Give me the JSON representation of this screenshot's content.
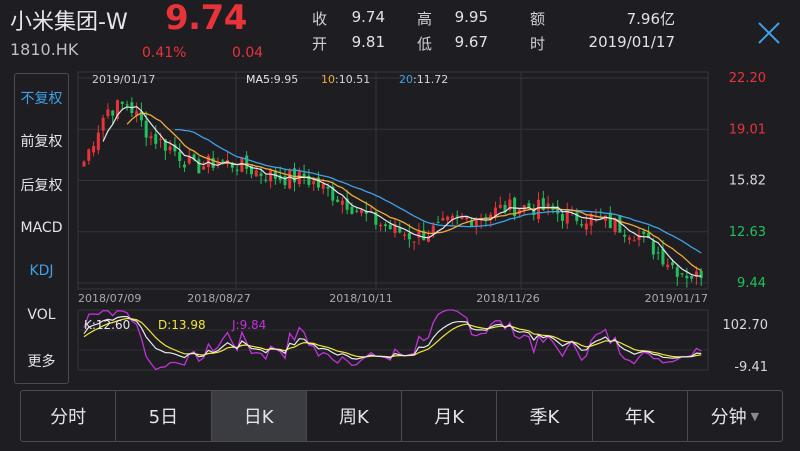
{
  "header": {
    "name": "小米集团-W",
    "code": "1810.HK",
    "price": "9.74",
    "change_pct": "0.41%",
    "change": "0.04",
    "info": [
      {
        "label": "收",
        "value": "9.74"
      },
      {
        "label": "开",
        "value": "9.81"
      },
      {
        "label": "高",
        "value": "9.95"
      },
      {
        "label": "低",
        "value": "9.67"
      },
      {
        "label": "额",
        "value": "7.96亿"
      },
      {
        "label": "时",
        "value": "2019/01/17"
      }
    ],
    "close_icon": "close-icon"
  },
  "sidebar": {
    "items": [
      {
        "label": "不复权",
        "active": true
      },
      {
        "label": "前复权",
        "active": false
      },
      {
        "label": "后复权",
        "active": false
      },
      {
        "label": "MACD",
        "active": false
      },
      {
        "label": "KDJ",
        "active": true
      },
      {
        "label": "VOL",
        "active": false
      },
      {
        "label": "更多",
        "active": false
      }
    ]
  },
  "tabs": [
    {
      "label": "分时",
      "active": false
    },
    {
      "label": "5日",
      "active": false
    },
    {
      "label": "日K",
      "active": true
    },
    {
      "label": "周K",
      "active": false
    },
    {
      "label": "月K",
      "active": false
    },
    {
      "label": "季K",
      "active": false
    },
    {
      "label": "年K",
      "active": false
    },
    {
      "label": "分钟",
      "active": false,
      "dropdown": true
    }
  ],
  "colors": {
    "up": "#e8333a",
    "down": "#21c05b",
    "ma5": "#e8e8ec",
    "ma10": "#f2a93a",
    "ma20": "#3fa0e6",
    "k": "#e8e8ec",
    "d": "#f2e63a",
    "j": "#c033d8"
  },
  "chart_data": [
    {
      "type": "candlestick",
      "current_date": "2019/01/17",
      "legend": [
        {
          "name": "MA5",
          "value": "9.95",
          "color": "#e8e8ec"
        },
        {
          "name": "10",
          "value": "10.51",
          "color": "#f2a93a"
        },
        {
          "name": "20",
          "value": "11.72",
          "color": "#3fa0e6"
        }
      ],
      "y_ticks": [
        "22.20",
        "19.01",
        "15.82",
        "12.63",
        "9.44"
      ],
      "x_ticks": [
        "2018/07/09",
        "2018/08/27",
        "2018/10/11",
        "2018/11/26",
        "2019/01/17"
      ],
      "ylim": [
        9.44,
        22.2
      ],
      "close_trend": [
        {
          "date": "2018/07/09",
          "value": 17.0
        },
        {
          "date": "2018/07/17",
          "value": 20.2
        },
        {
          "date": "2018/07/24",
          "value": 20.6
        },
        {
          "date": "2018/08/01",
          "value": 18.6
        },
        {
          "date": "2018/08/08",
          "value": 17.8
        },
        {
          "date": "2018/08/15",
          "value": 16.6
        },
        {
          "date": "2018/08/22",
          "value": 17.0
        },
        {
          "date": "2018/08/27",
          "value": 16.8
        },
        {
          "date": "2018/09/05",
          "value": 16.3
        },
        {
          "date": "2018/09/13",
          "value": 16.0
        },
        {
          "date": "2018/09/20",
          "value": 16.0
        },
        {
          "date": "2018/09/28",
          "value": 15.2
        },
        {
          "date": "2018/10/05",
          "value": 14.4
        },
        {
          "date": "2018/10/11",
          "value": 13.4
        },
        {
          "date": "2018/10/18",
          "value": 12.8
        },
        {
          "date": "2018/10/25",
          "value": 12.3
        },
        {
          "date": "2018/11/01",
          "value": 12.8
        },
        {
          "date": "2018/11/08",
          "value": 13.4
        },
        {
          "date": "2018/11/15",
          "value": 13.6
        },
        {
          "date": "2018/11/22",
          "value": 14.1
        },
        {
          "date": "2018/11/26",
          "value": 14.2
        },
        {
          "date": "2018/12/03",
          "value": 14.0
        },
        {
          "date": "2018/12/10",
          "value": 13.6
        },
        {
          "date": "2018/12/17",
          "value": 13.5
        },
        {
          "date": "2018/12/24",
          "value": 13.1
        },
        {
          "date": "2018/12/31",
          "value": 12.6
        },
        {
          "date": "2019/01/07",
          "value": 11.4
        },
        {
          "date": "2019/01/14",
          "value": 10.2
        },
        {
          "date": "2019/01/17",
          "value": 9.74
        }
      ]
    },
    {
      "type": "line",
      "indicator": "KDJ",
      "legend": [
        {
          "name": "K",
          "value": "12.60",
          "color": "#e8e8ec"
        },
        {
          "name": "D",
          "value": "13.98",
          "color": "#f2e63a"
        },
        {
          "name": "J",
          "value": "9.84",
          "color": "#c033d8"
        }
      ],
      "y_ticks": [
        "102.70",
        "-9.41"
      ],
      "ylim": [
        -9.41,
        102.7
      ]
    }
  ],
  "labels": {
    "candle_legend_date": "2019/01/17",
    "kdj_k": "K:12.60",
    "kdj_d": "D:13.98",
    "kdj_j": "J:9.84"
  }
}
